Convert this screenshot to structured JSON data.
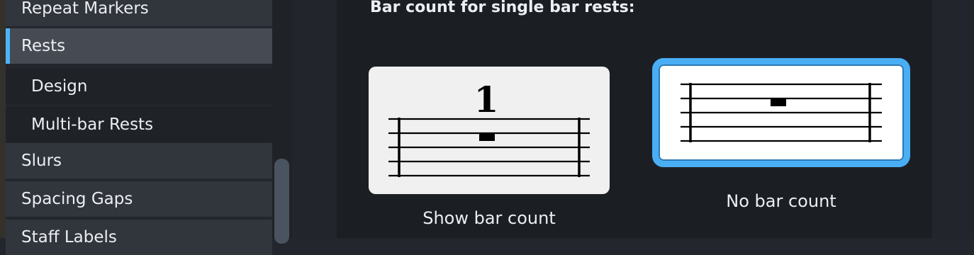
{
  "sidebar": {
    "items": [
      {
        "label": "Repeat Markers"
      },
      {
        "label": "Rests"
      },
      {
        "label": "Design"
      },
      {
        "label": "Multi-bar Rests"
      },
      {
        "label": "Slurs"
      },
      {
        "label": "Spacing Gaps"
      },
      {
        "label": "Staff Labels"
      }
    ],
    "selected": "Rests"
  },
  "main": {
    "section_title": "Bar count for single bar rests:",
    "options": [
      {
        "label": "Show bar count",
        "bar_number": "1",
        "selected": false
      },
      {
        "label": "No bar count",
        "selected": true
      }
    ]
  },
  "colors": {
    "accent": "#4aaef5",
    "selection_marker": "#4db4f9"
  }
}
